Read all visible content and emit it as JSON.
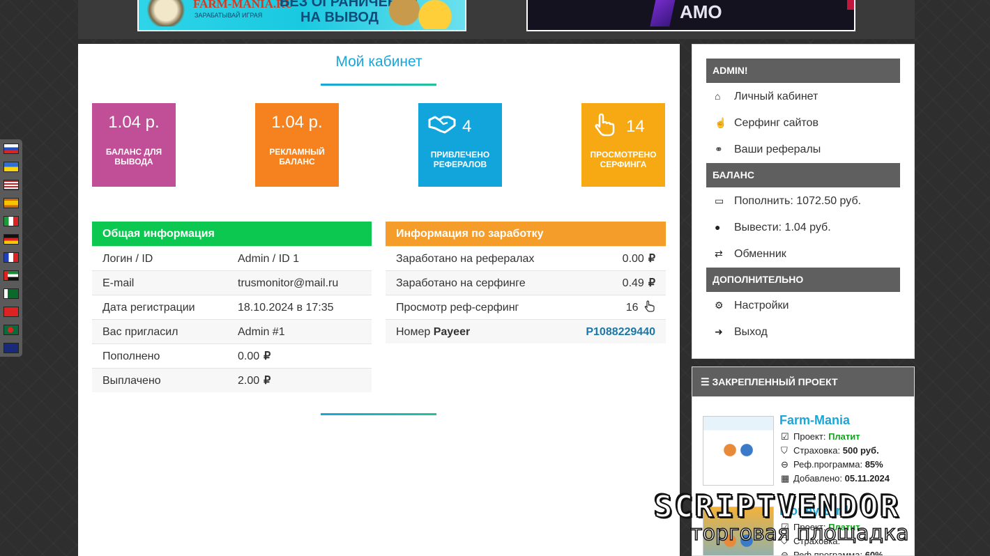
{
  "banners": {
    "left": {
      "brand": "FARM-MANIA.RU",
      "sub": "ЗАРАБАТЫВАЙ ИГРАЯ",
      "line1": "БЕЗ ОГРАНИЧЕНИЙ",
      "line2": "НА ВЫВОД"
    },
    "right": {
      "text": "AMO"
    }
  },
  "cabinet": {
    "title": "Мой кабинет",
    "stats": [
      {
        "value": "1.04 р.",
        "label": "БАЛАНС ДЛЯ ВЫВОДА",
        "color": "#c04f97"
      },
      {
        "value": "1.04 р.",
        "label": "РЕКЛАМНЫЙ БАЛАНС",
        "color": "#f5821f"
      },
      {
        "value": "4",
        "label": "ПРИВЛЕЧЕНО РЕФЕРАЛОВ",
        "icon": "handshake-icon",
        "color": "#12a5dc"
      },
      {
        "value": "14",
        "label": "ПРОСМОТРЕНО СЕРФИНГА",
        "icon": "pointer-hand-icon",
        "color": "#f7a913"
      }
    ]
  },
  "general_info": {
    "title": "Общая информация",
    "color": "#0dc850",
    "rows": [
      {
        "key": "Логин / ID",
        "value": "Admin / ID 1"
      },
      {
        "key": "E-mail",
        "value": "trusmonitor@mail.ru"
      },
      {
        "key": "Дата регистрации",
        "value": "18.10.2024 в 17:35"
      },
      {
        "key": "Вас пригласил",
        "value": "Admin #1"
      },
      {
        "key": "Пополнено",
        "value": "0.00",
        "currency": "₽"
      },
      {
        "key": "Выплачено",
        "value": "2.00",
        "currency": "₽"
      }
    ]
  },
  "earnings_info": {
    "title": "Информация по заработку",
    "color": "#f59d2a",
    "rows": [
      {
        "key": "Заработано на рефералах",
        "value": "0.00",
        "currency": "₽"
      },
      {
        "key": "Заработано на серфинге",
        "value": "0.49",
        "currency": "₽"
      },
      {
        "key": "Просмотр реф-серфинг",
        "value": "16",
        "icon": "pointer-hand-icon"
      },
      {
        "key_prefix": "Номер ",
        "key_bold": "Payeer",
        "value": "P1088229440"
      }
    ]
  },
  "sidebar": {
    "sections": [
      {
        "title": "ADMIN!",
        "items": [
          {
            "icon": "home-icon",
            "label": "Личный кабинет"
          },
          {
            "icon": "pointer-hand-icon",
            "label": "Серфинг сайтов"
          },
          {
            "icon": "handshake-icon",
            "label": "Ваши рефералы"
          }
        ]
      },
      {
        "title": "БАЛАНС",
        "items": [
          {
            "icon": "credit-card-icon",
            "label": "Пополнить: 1072.50 руб."
          },
          {
            "icon": "payeer-icon",
            "label": "Вывести: 1.04 руб."
          },
          {
            "icon": "exchange-icon",
            "label": "Обменник"
          }
        ]
      },
      {
        "title": "ДОПОЛНИТЕЛЬНО",
        "items": [
          {
            "icon": "gear-icon",
            "label": "Настройки"
          },
          {
            "icon": "logout-icon",
            "label": "Выход"
          }
        ]
      }
    ]
  },
  "pinned": {
    "title": "ЗАКРЕПЛЕННЫЙ ПРОЕКТ",
    "projects": [
      {
        "name": "Farm-Mania",
        "project_label": "Проект:",
        "project_status": "Платит",
        "insurance_label": "Страховка:",
        "insurance_value": "500 руб.",
        "ref_label": "Реф.программа:",
        "ref_value": "85%",
        "added_label": "Добавлено:",
        "added_value": "05.11.2024"
      },
      {
        "name": "Money-Birds",
        "project_label": "Проект:",
        "project_status": "Платит",
        "insurance_label": "Страховка:",
        "ref_label": "Реф.программа:",
        "ref_value": "60%"
      }
    ]
  },
  "watermark": {
    "line1": "SCRIPTVENDOR",
    "line2": "торговая площадка"
  }
}
